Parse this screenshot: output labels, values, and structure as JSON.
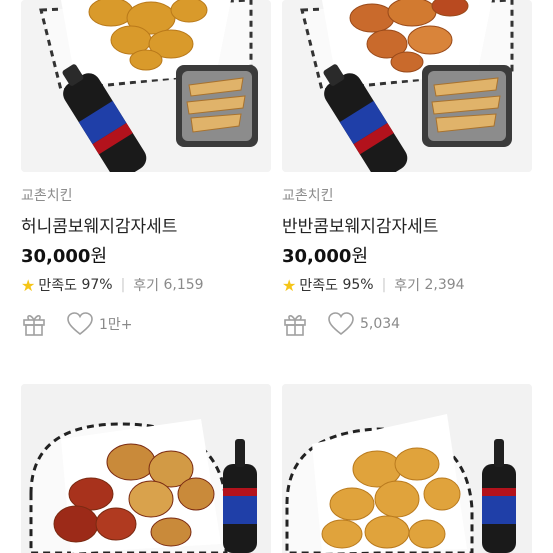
{
  "products": [
    {
      "brand": "교촌치킨",
      "name": "허니콤보웨지감자세트",
      "price": "30,000",
      "unit": "원",
      "star": "★",
      "satisfaction_label": "만족도",
      "satisfaction": "97%",
      "review_label": "후기",
      "reviews": "6,159",
      "likes": "1만+"
    },
    {
      "brand": "교촌치킨",
      "name": "반반콤보웨지감자세트",
      "price": "30,000",
      "unit": "원",
      "star": "★",
      "satisfaction_label": "만족도",
      "satisfaction": "95%",
      "review_label": "후기",
      "reviews": "2,394",
      "likes": "5,034"
    }
  ],
  "icons": {
    "gift": "gift-icon",
    "heart": "heart-icon",
    "star": "star-icon"
  },
  "colors": {
    "star": "#f5c518",
    "brand_text": "#8c8c8c",
    "meta_text": "#8a8a8a",
    "icon": "#a0a0a0"
  }
}
